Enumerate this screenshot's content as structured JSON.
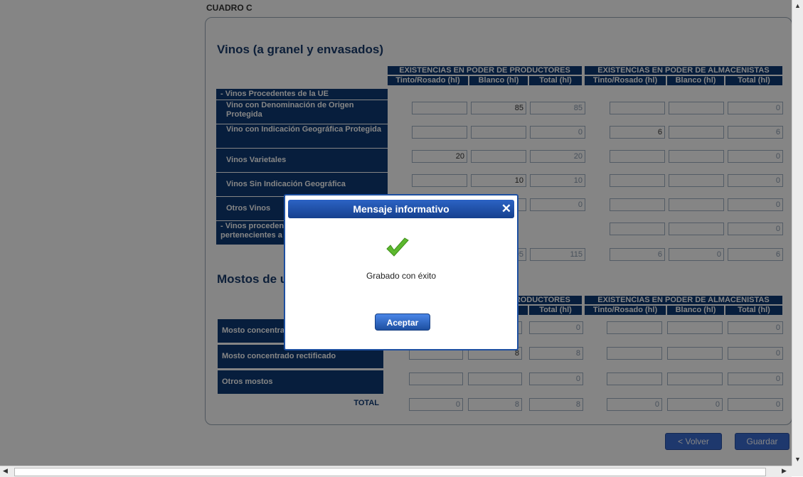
{
  "section_tab": "CUADRO C",
  "vinos": {
    "title": "Vinos (a granel y envasados)",
    "group_productores": "EXISTENCIAS EN PODER DE PRODUCTORES",
    "group_almacenistas": "EXISTENCIAS EN PODER DE ALMACENISTAS",
    "col_tinto": "Tinto/Rosado (hl)",
    "col_blanco": "Blanco (hl)",
    "col_total": "Total (hl)",
    "rows": [
      {
        "label": "- Vinos Procedentes de la UE",
        "values": []
      },
      {
        "label": "Vino con Denominación de Origen Protegida",
        "values": [
          "",
          "85",
          "85",
          "",
          "",
          "0"
        ]
      },
      {
        "label": "Vino con Indicación Geográfica Protegida",
        "values": [
          "",
          "",
          "0",
          "6",
          "",
          "6"
        ]
      },
      {
        "label": "Vinos Varietales",
        "values": [
          "20",
          "",
          "20",
          "",
          "",
          "0"
        ]
      },
      {
        "label": "Vinos Sin Indicación Geográfica",
        "values": [
          "",
          "10",
          "10",
          "",
          "",
          "0"
        ]
      },
      {
        "label": "Otros Vinos",
        "values": [
          "",
          "",
          "0",
          "",
          "",
          "0"
        ]
      },
      {
        "label": "- Vinos procedentes de países no pertenecientes a la UE",
        "values": [
          "",
          "",
          "",
          "",
          "",
          "0"
        ]
      },
      {
        "label": "",
        "values": [
          "",
          "95",
          "115",
          "6",
          "0",
          "6"
        ]
      }
    ]
  },
  "mostos": {
    "title": "Mostos de uva",
    "group_productores": "EXISTENCIAS EN PODER DE PRODUCTORES",
    "group_almacenistas": "EXISTENCIAS EN PODER DE ALMACENISTAS",
    "col_tinto": "Tinto/Rosado (hl)",
    "col_blanco": "Blanco (hl)",
    "col_total": "Total (hl)",
    "rows": [
      {
        "label": "Mosto concentrado",
        "values": [
          "",
          "",
          "0",
          "",
          "",
          "0"
        ]
      },
      {
        "label": "Mosto concentrado rectificado",
        "values": [
          "",
          "8",
          "8",
          "",
          "",
          "0"
        ]
      },
      {
        "label": "Otros mostos",
        "values": [
          "",
          "",
          "0",
          "",
          "",
          "0"
        ]
      },
      {
        "label": "TOTAL",
        "values": [
          "0",
          "8",
          "8",
          "0",
          "0",
          "0"
        ]
      }
    ]
  },
  "buttons": {
    "volver": "< Volver",
    "guardar": "Guardar"
  },
  "modal": {
    "title": "Mensaje informativo",
    "close": "✕",
    "message": "Grabado con éxito",
    "accept": "Aceptar",
    "icon": "check-icon"
  },
  "colors": {
    "header_blue": "#0f3b75",
    "button_blue": "#3b6bd1",
    "check_green": "#5cb82e"
  }
}
